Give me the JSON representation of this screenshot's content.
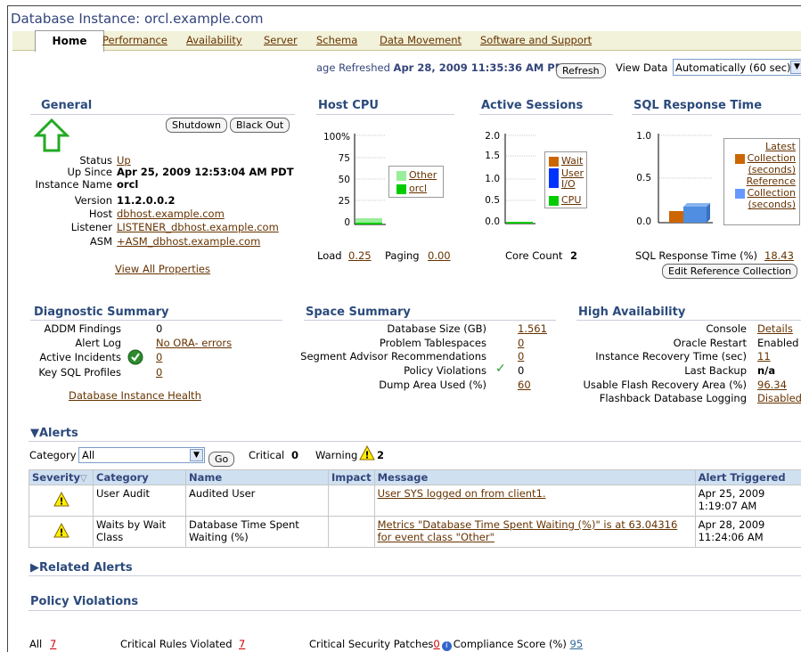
{
  "header": {
    "title": "Database Instance: orcl.example.com"
  },
  "tabs": [
    {
      "label": "Home"
    },
    {
      "label": "Performance"
    },
    {
      "label": "Availability"
    },
    {
      "label": "Server"
    },
    {
      "label": "Schema"
    },
    {
      "label": "Data Movement"
    },
    {
      "label": "Software and Support"
    }
  ],
  "refresh": {
    "text": "age Refreshed ",
    "time": "Apr 28, 2009 11:35:36 AM PDT",
    "button": "Refresh",
    "view_label": "View Data",
    "view_value": "Automatically (60 sec)"
  },
  "general": {
    "title": "General",
    "shutdown": "Shutdown",
    "blackout": "Black Out",
    "status_label": "Status",
    "status_value": "Up",
    "upsince_label": "Up Since",
    "upsince_value": "Apr 25, 2009 12:53:04 AM PDT",
    "instance_label": "Instance Name",
    "instance_value": "orcl",
    "version_label": "Version",
    "version_value": "11.2.0.0.2",
    "host_label": "Host",
    "host_value": "dbhost.example.com",
    "listener_label": "Listener",
    "listener_value": "LISTENER_dbhost.example.com",
    "asm_label": "ASM",
    "asm_value": "+ASM_dbhost.example.com",
    "view_all": "View All Properties"
  },
  "host_cpu": {
    "title": "Host CPU",
    "ticks": [
      "100%",
      "75",
      "50",
      "25",
      "0"
    ],
    "legend": [
      "Other",
      "orcl"
    ],
    "load_label": "Load",
    "load_value": "0.25",
    "paging_label": "Paging",
    "paging_value": "0.00",
    "colors": {
      "other": "#99ee99",
      "orcl": "#00cc00"
    }
  },
  "active_sessions": {
    "title": "Active Sessions",
    "ticks": [
      "2.0",
      "1.5",
      "1.0",
      "0.5",
      "0.0"
    ],
    "legend": [
      "Wait",
      "User",
      "I/O",
      "CPU"
    ],
    "core_label": "Core Count",
    "core_value": "2",
    "colors": {
      "wait": "#cc6600",
      "user_io": "#0033ff",
      "cpu": "#00cc00"
    }
  },
  "sql_response": {
    "title": "SQL Response Time",
    "ticks": [
      "1.0",
      "0.5",
      "0.0"
    ],
    "legend": [
      "Latest",
      "Collection",
      "(seconds)",
      "Reference",
      "Collection",
      "(seconds)"
    ],
    "pct_label": "SQL Response Time (%)",
    "pct_value": "18.43",
    "edit_button": "Edit Reference Collection",
    "colors": {
      "latest": "#cc6600",
      "reference": "#6699ff"
    }
  },
  "diagnostic": {
    "title": "Diagnostic Summary",
    "addm_label": "ADDM Findings",
    "addm_value": "0",
    "alert_label": "Alert Log",
    "alert_value": "No ORA- errors",
    "incidents_label": "Active Incidents",
    "incidents_value": "0",
    "keysql_label": "Key SQL Profiles",
    "keysql_value": "0",
    "health_link": "Database Instance Health"
  },
  "space": {
    "title": "Space Summary",
    "rows": [
      {
        "label": "Database Size (GB)",
        "value": "1.561"
      },
      {
        "label": "Problem Tablespaces",
        "value": "0"
      },
      {
        "label": "Segment Advisor Recommendations",
        "value": "0"
      },
      {
        "label": "Policy Violations",
        "value": "0"
      },
      {
        "label": "Dump Area Used (%)",
        "value": "60"
      }
    ]
  },
  "ha": {
    "title": "High Availability",
    "rows": [
      {
        "label": "Console",
        "value": "Details"
      },
      {
        "label": "Oracle Restart",
        "value": "Enabled"
      },
      {
        "label": "Instance Recovery Time (sec)",
        "value": "11"
      },
      {
        "label": "Last Backup",
        "value": "n/a"
      },
      {
        "label": "Usable Flash Recovery Area (%)",
        "value": "96.34"
      },
      {
        "label": "Flashback Database Logging",
        "value": "Disabled"
      }
    ]
  },
  "alerts": {
    "title": "Alerts",
    "category_label": "Category",
    "category_value": "All",
    "go": "Go",
    "critical_label": "Critical",
    "critical_value": "0",
    "warning_label": "Warning",
    "warning_value": "2",
    "columns": [
      "Severity",
      "Category",
      "Name",
      "Impact",
      "Message",
      "Alert Triggered"
    ],
    "rows": [
      {
        "category": "User Audit",
        "name": "Audited User",
        "impact": "",
        "message": "User SYS logged on from client1.",
        "triggered": "Apr 25, 2009 1:19:07 AM"
      },
      {
        "category": "Waits by Wait Class",
        "name": "Database Time Spent Waiting (%)",
        "impact": "",
        "message": "Metrics \"Database Time Spent Waiting (%)\" is at 63.04316 for event class \"Other\"",
        "triggered": "Apr 28, 2009 11:24:06 AM"
      }
    ]
  },
  "related": {
    "title": "Related Alerts"
  },
  "policy": {
    "title": "Policy Violations",
    "all_label": "All",
    "all_value": "7",
    "crit_label": "Critical Rules Violated",
    "crit_value": "7",
    "patch_label": "Critical Security Patches",
    "patch_value": "0",
    "compliance_label": "Compliance Score (%)",
    "compliance_value": "95"
  }
}
